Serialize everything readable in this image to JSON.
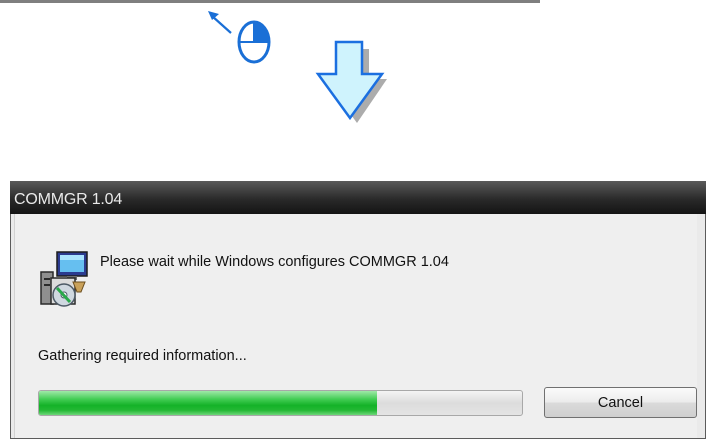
{
  "window": {
    "title": "COMMGR 1.04",
    "message": "Please wait while Windows configures COMMGR 1.04",
    "status": "Gathering required information...",
    "cancel_label": "Cancel",
    "progress": 0.7
  },
  "icons": {
    "mouse": "mouse-left-click-icon",
    "arrow": "down-arrow-icon",
    "installer": "installer-setup-icon"
  },
  "colors": {
    "arrow_fill": "#cff3fd",
    "arrow_stroke": "#1b6fe0",
    "progress_green": "#14b228",
    "titlebar": "#1e1e1e"
  }
}
